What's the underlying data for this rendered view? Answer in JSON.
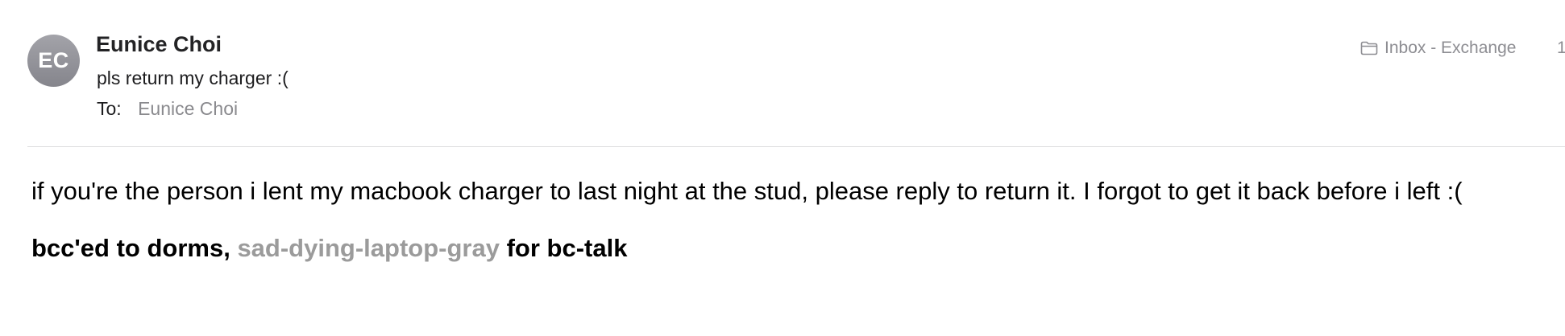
{
  "header": {
    "avatar_initials": "EC",
    "sender_name": "Eunice Choi",
    "subject": "pls return my charger :(",
    "to_label": "To:",
    "to_value": "Eunice Choi",
    "mailbox_icon": "folder-icon",
    "mailbox_label": "Inbox - Exchange",
    "timestamp_partial": "1"
  },
  "body": {
    "paragraph": "if you're the person i lent my macbook charger to last night at the stud, please reply to return it. I forgot to get it back before i left :(",
    "bcc_prefix": "bcc'ed to dorms,",
    "bcc_hidden_text": "sad-dying-laptop-gray",
    "bcc_suffix": "for bc-talk"
  },
  "colors": {
    "avatar_bg": "#8e8e94",
    "secondary_text": "#8a8a8e",
    "hidden_text_gray": "#9b9b9b",
    "divider": "#dcdcde"
  }
}
